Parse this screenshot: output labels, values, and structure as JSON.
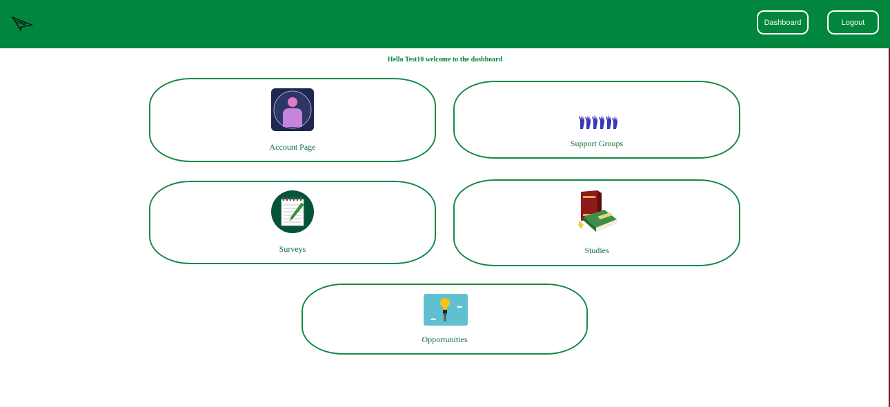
{
  "header": {
    "logo_icon": "paper-plane-logo-icon",
    "dashboard_label": "Dashboard",
    "logout_label": "Logout",
    "bar_color": "#02853c"
  },
  "welcome": {
    "text": "Hello Test10 welcome to the dashboard"
  },
  "cards": {
    "account": {
      "label": "Account Page",
      "icon": "user-profile-icon"
    },
    "support": {
      "label": "Support Groups",
      "icon": "raised-hands-icon"
    },
    "surveys": {
      "label": "Surveys",
      "icon": "notepad-pencil-icon"
    },
    "studies": {
      "label": "Studies",
      "icon": "books-icon"
    },
    "opportunities": {
      "label": "Opportunities",
      "icon": "lightbulb-icon"
    }
  },
  "colors": {
    "accent": "#02853c",
    "card_border": "#138a48",
    "label_text": "#0e6b3a"
  }
}
